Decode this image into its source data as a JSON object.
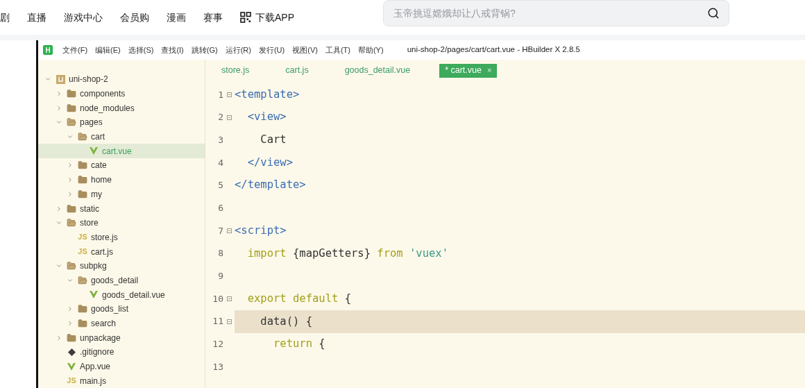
{
  "top_nav": {
    "items": [
      {
        "label": "剧",
        "kind": "text"
      },
      {
        "label": "直播",
        "kind": "text"
      },
      {
        "label": "游戏中心",
        "kind": "text"
      },
      {
        "label": "会员购",
        "kind": "text"
      },
      {
        "label": "漫画",
        "kind": "text"
      },
      {
        "label": "赛事",
        "kind": "text"
      },
      {
        "label": "下载APP",
        "kind": "qr"
      }
    ],
    "search": {
      "placeholder": "玉帝挑逗嫦娥却让八戒背锅?"
    }
  },
  "ide": {
    "logo": "H",
    "menu": [
      "文件(F)",
      "编辑(E)",
      "选择(S)",
      "查找(I)",
      "跳转(G)",
      "运行(R)",
      "发行(U)",
      "视图(V)",
      "工具(T)",
      "帮助(Y)"
    ],
    "title": "uni-shop-2/pages/cart/cart.vue - HBuilder X 2.8.5",
    "tree": [
      {
        "name": "uni-shop-2",
        "kind": "project",
        "expanded": true,
        "selected": false,
        "children": [
          {
            "name": "components",
            "kind": "folder",
            "expanded": false,
            "selected": false
          },
          {
            "name": "node_modules",
            "kind": "folder",
            "expanded": false,
            "selected": false
          },
          {
            "name": "pages",
            "kind": "folder",
            "expanded": true,
            "selected": false,
            "children": [
              {
                "name": "cart",
                "kind": "folder",
                "expanded": true,
                "selected": false,
                "children": [
                  {
                    "name": "cart.vue",
                    "kind": "vue",
                    "selected": true
                  }
                ]
              },
              {
                "name": "cate",
                "kind": "folder",
                "expanded": false,
                "selected": false
              },
              {
                "name": "home",
                "kind": "folder",
                "expanded": false,
                "selected": false
              },
              {
                "name": "my",
                "kind": "folder",
                "expanded": false,
                "selected": false
              }
            ]
          },
          {
            "name": "static",
            "kind": "folder",
            "expanded": false,
            "selected": false
          },
          {
            "name": "store",
            "kind": "folder",
            "expanded": true,
            "selected": false,
            "children": [
              {
                "name": "store.js",
                "kind": "js",
                "icon_text": "JS",
                "selected": false
              },
              {
                "name": "cart.js",
                "kind": "js",
                "icon_text": "JS",
                "selected": false
              }
            ]
          },
          {
            "name": "subpkg",
            "kind": "folder",
            "expanded": true,
            "selected": false,
            "children": [
              {
                "name": "goods_detail",
                "kind": "folder",
                "expanded": true,
                "selected": false,
                "children": [
                  {
                    "name": "goods_detail.vue",
                    "kind": "vue",
                    "selected": false
                  }
                ]
              },
              {
                "name": "goods_list",
                "kind": "folder",
                "expanded": false,
                "selected": false
              },
              {
                "name": "search",
                "kind": "folder",
                "expanded": false,
                "selected": false
              }
            ]
          },
          {
            "name": "unpackage",
            "kind": "folder",
            "expanded": false,
            "selected": false
          },
          {
            "name": ".gitignore",
            "kind": "git",
            "selected": false
          },
          {
            "name": "App.vue",
            "kind": "vue",
            "selected": false
          },
          {
            "name": "main.js",
            "kind": "js",
            "icon_text": "JS",
            "selected": false
          }
        ]
      }
    ],
    "tabs": [
      {
        "label": "store.js",
        "selected": false
      },
      {
        "label": "cart.js",
        "selected": false
      },
      {
        "label": "goods_detail.vue",
        "selected": false
      },
      {
        "label": "* cart.vue",
        "selected": true,
        "close": "×"
      }
    ],
    "lines": [
      {
        "number": "1",
        "fold": true,
        "current": false,
        "tokens": [
          {
            "text": "<template>",
            "kind": "tag"
          }
        ]
      },
      {
        "number": "2",
        "fold": true,
        "current": false,
        "tokens": [
          {
            "text": "  <view>",
            "kind": "tag"
          }
        ]
      },
      {
        "number": "3",
        "fold": false,
        "current": false,
        "tokens": [
          {
            "text": "    Cart",
            "kind": "plain"
          }
        ]
      },
      {
        "number": "4",
        "fold": false,
        "current": false,
        "tokens": [
          {
            "text": "  </view>",
            "kind": "tag"
          }
        ]
      },
      {
        "number": "5",
        "fold": false,
        "current": false,
        "tokens": [
          {
            "text": "</template>",
            "kind": "tag"
          }
        ]
      },
      {
        "number": "6",
        "fold": false,
        "current": false
      },
      {
        "number": "7",
        "fold": true,
        "current": false,
        "tokens": [
          {
            "text": "<script>",
            "kind": "tag"
          }
        ]
      },
      {
        "number": "8",
        "fold": false,
        "current": false,
        "tokens": [
          {
            "text": "  import",
            "kind": "keyword"
          },
          {
            "text": " {mapGetters} ",
            "kind": "plain"
          },
          {
            "text": "from",
            "kind": "keyword"
          },
          {
            "text": " 'vuex'",
            "kind": "string"
          }
        ]
      },
      {
        "number": "9",
        "fold": false,
        "current": false
      },
      {
        "number": "10",
        "fold": true,
        "current": false,
        "tokens": [
          {
            "text": "  export default",
            "kind": "keyword"
          },
          {
            "text": " {",
            "kind": "plain"
          }
        ]
      },
      {
        "number": "11",
        "fold": true,
        "current": true,
        "tokens": [
          {
            "text": "    data() {",
            "kind": "plain"
          }
        ]
      },
      {
        "number": "12",
        "fold": false,
        "current": false,
        "tokens": [
          {
            "text": "      return",
            "kind": "keyword"
          },
          {
            "text": " {",
            "kind": "plain"
          }
        ]
      },
      {
        "number": "13",
        "fold": false,
        "current": false
      }
    ]
  }
}
